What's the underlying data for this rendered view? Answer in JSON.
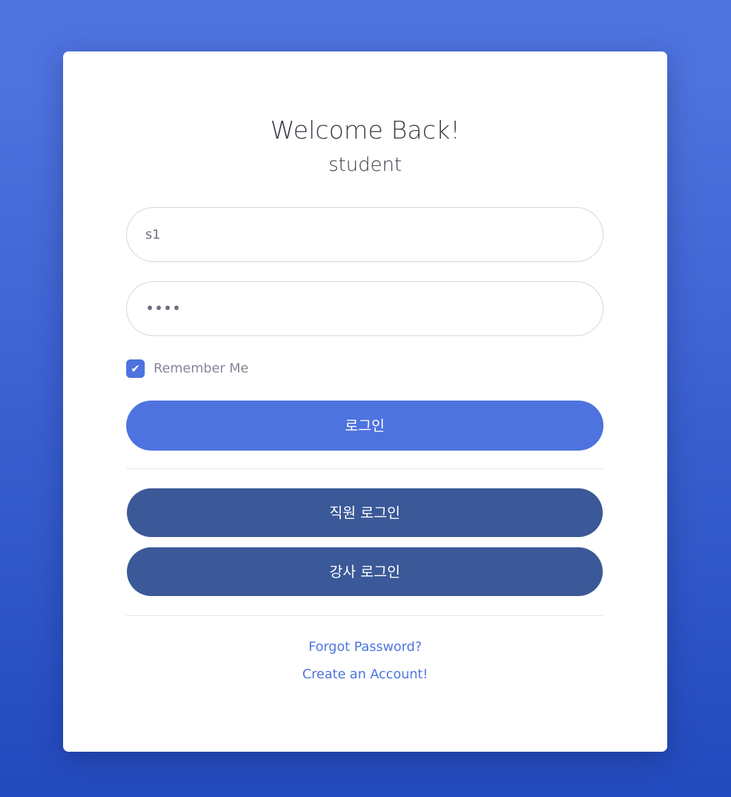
{
  "header": {
    "title": "Welcome Back!",
    "subtitle": "student"
  },
  "form": {
    "username_value": "s1",
    "password_value": "1234",
    "remember_label": "Remember Me",
    "remember_checked": true,
    "login_label": "로그인"
  },
  "alt_logins": {
    "staff_label": "직원 로그인",
    "instructor_label": "강사 로그인"
  },
  "links": {
    "forgot": "Forgot Password?",
    "create": "Create an Account!"
  },
  "colors": {
    "accent": "#4e73df",
    "secondary_button": "#3b5998"
  },
  "icons": {
    "checkbox": "check-icon"
  }
}
